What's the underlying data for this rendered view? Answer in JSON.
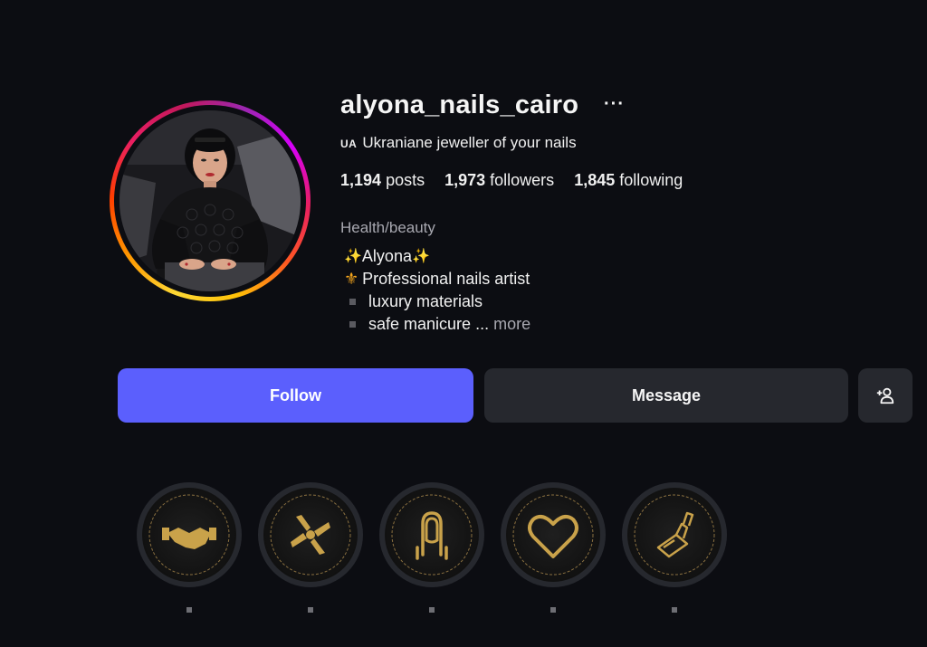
{
  "profile": {
    "username": "alyona_nails_cairo",
    "more_options": "···",
    "tagline_flag": "UA",
    "tagline": "Ukraniane jeweller of your nails",
    "category": "Health/beauty"
  },
  "stats": {
    "posts_count": "1,194",
    "posts_label": "posts",
    "followers_count": "1,973",
    "followers_label": "followers",
    "following_count": "1,845",
    "following_label": "following"
  },
  "bio": {
    "line1_sparkle_left": "✨",
    "line1_text": "Alyona",
    "line1_sparkle_right": "✨",
    "line2_icon": "⚜",
    "line2_text": "Professional nails artist",
    "line3_text": "luxury materials",
    "line4_text": "safe manicure",
    "line4_ellipsis": " ... ",
    "more_label": "more"
  },
  "actions": {
    "follow_label": "Follow",
    "message_label": "Message",
    "add_user_icon": "person-add-icon"
  },
  "highlights": [
    {
      "icon": "handshake-icon"
    },
    {
      "icon": "hands-together-icon"
    },
    {
      "icon": "nail-icon"
    },
    {
      "icon": "heart-icon"
    },
    {
      "icon": "nail-polish-icon"
    }
  ],
  "colors": {
    "accent": "#5b5ffd",
    "gold": "#c9a24a",
    "background": "#0c0d12",
    "button_dark": "#26282e"
  }
}
